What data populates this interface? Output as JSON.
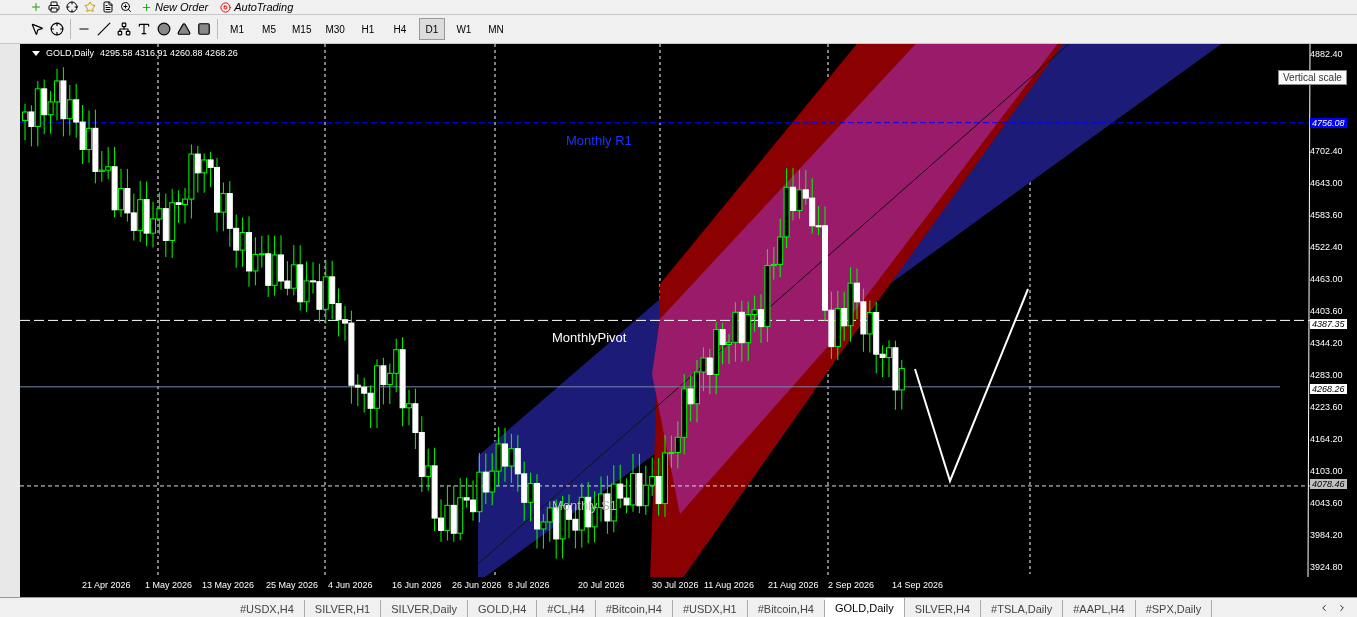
{
  "toolbar_top": {
    "buttons": [
      {
        "label": "New Order"
      },
      {
        "label": "AutoTrading"
      }
    ]
  },
  "toolbar_tools": {
    "timeframes": [
      {
        "label": "M1",
        "selected": false
      },
      {
        "label": "M5",
        "selected": false
      },
      {
        "label": "M15",
        "selected": false
      },
      {
        "label": "M30",
        "selected": false
      },
      {
        "label": "H1",
        "selected": false
      },
      {
        "label": "H4",
        "selected": false
      },
      {
        "label": "D1",
        "selected": true
      },
      {
        "label": "W1",
        "selected": false
      },
      {
        "label": "MN",
        "selected": false
      }
    ]
  },
  "chart": {
    "symbol": "GOLD,Daily",
    "ohlc": "4295.58 4316.91 4260.88 4268.26",
    "levels": [
      {
        "label": "Monthly R1",
        "kind": "r1"
      },
      {
        "label": "MonthlyPivot",
        "kind": "pivot"
      },
      {
        "label": "Monthly S1",
        "kind": "s1"
      }
    ],
    "price_ticks": [
      "4882.40",
      "4702.40",
      "4643.00",
      "4583.60",
      "4522.40",
      "4463.00",
      "4403.60",
      "4344.20",
      "4283.00",
      "4223.60",
      "4164.20",
      "4103.00",
      "4043.60",
      "3984.20",
      "3924.80"
    ],
    "price_markers": [
      {
        "text": "4756.08",
        "color": "#0000ff"
      },
      {
        "text": "4387.35",
        "color": "#ffffff"
      },
      {
        "text": "4268.26",
        "color": "#ffffff"
      },
      {
        "text": "4078.46",
        "color": "#c0c0c0"
      }
    ],
    "dates": [
      "21 Apr 2026",
      "1 May 2026",
      "13 May 2026",
      "25 May 2026",
      "4 Jun 2026",
      "16 Jun 2026",
      "26 Jun 2026",
      "8 Jul 2026",
      "20 Jul 2026",
      "30 Jul 2026",
      "11 Aug 2026",
      "21 Aug 2026",
      "2 Sep 2026",
      "14 Sep 2026"
    ],
    "tooltip": "Vertical scale"
  },
  "tabs": [
    {
      "label": "#USDX,H4",
      "selected": false
    },
    {
      "label": "SILVER,H1",
      "selected": false
    },
    {
      "label": "SILVER,Daily",
      "selected": false
    },
    {
      "label": "GOLD,H4",
      "selected": false
    },
    {
      "label": "#CL,H4",
      "selected": false
    },
    {
      "label": "#Bitcoin,H4",
      "selected": false
    },
    {
      "label": "#USDX,H1",
      "selected": false
    },
    {
      "label": "#Bitcoin,H4",
      "selected": false
    },
    {
      "label": "GOLD,Daily",
      "selected": true
    },
    {
      "label": "SILVER,H4",
      "selected": false
    },
    {
      "label": "#TSLA,Daily",
      "selected": false
    },
    {
      "label": "#AAPL,H4",
      "selected": false
    },
    {
      "label": "#SPX,Daily",
      "selected": false
    }
  ]
}
